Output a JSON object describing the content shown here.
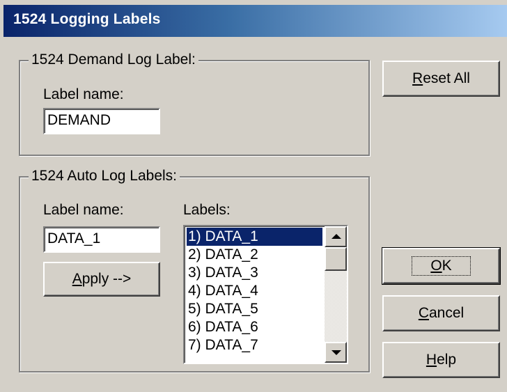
{
  "window": {
    "title": "1524 Logging Labels"
  },
  "demand_group": {
    "legend": "1524 Demand Log Label:",
    "label_name_caption": "Label name:",
    "label_name_value": "DEMAND"
  },
  "auto_group": {
    "legend": "1524 Auto Log Labels:",
    "label_name_caption": "Label name:",
    "label_name_value": "DATA_1",
    "labels_caption": "Labels:",
    "apply_button": {
      "mnemonic": "A",
      "rest": "pply -->"
    },
    "labels_list": [
      "1) DATA_1",
      "2) DATA_2",
      "3) DATA_3",
      "4) DATA_4",
      "5) DATA_5",
      "6) DATA_6",
      "7) DATA_7"
    ],
    "selected_index": 0
  },
  "buttons": {
    "reset_all": {
      "mnemonic": "R",
      "rest": "eset All"
    },
    "ok": {
      "mnemonic": "O",
      "rest": "K"
    },
    "cancel": {
      "mnemonic": "C",
      "rest": "ancel"
    },
    "help": {
      "mnemonic": "H",
      "rest": "elp"
    }
  },
  "colors": {
    "dialog_face": "#d4d0c8",
    "title_gradient_start": "#0a246a",
    "title_gradient_end": "#a6caf0",
    "selection": "#0a246a"
  }
}
